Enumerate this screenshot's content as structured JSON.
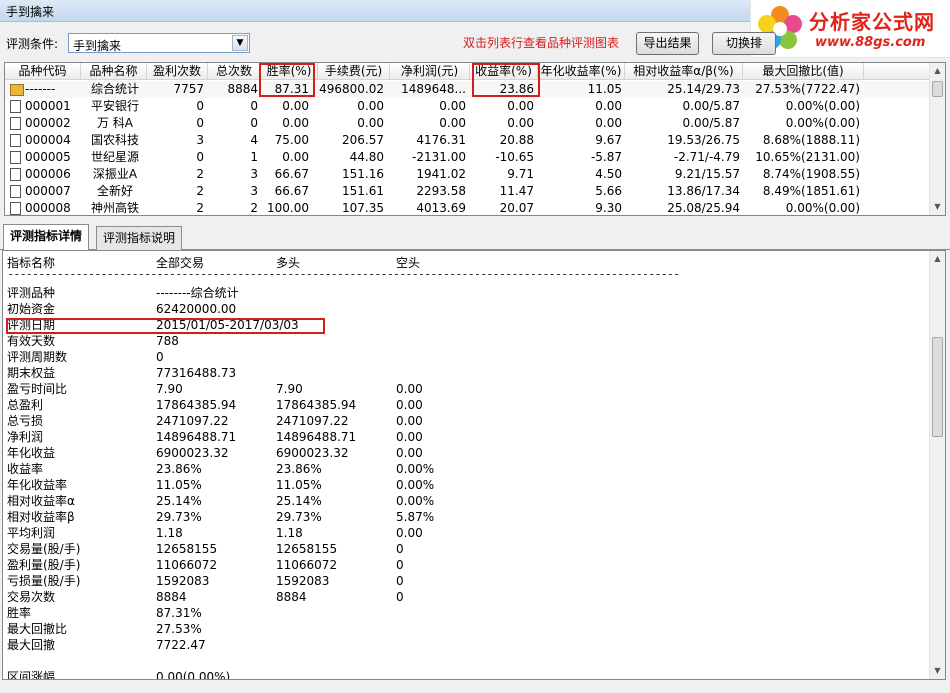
{
  "window": {
    "title": "手到擒来"
  },
  "logo": {
    "brand": "分析家公式网",
    "url": "www.88gs.com"
  },
  "toolbar": {
    "condition_label": "评测条件:",
    "condition_value": "手到擒来",
    "hint": "双击列表行查看品种评测图表",
    "export_label": "导出结果",
    "switch1_label": "切换排",
    "switch2_label": "切换分析"
  },
  "table": {
    "columns": [
      "品种代码",
      "品种名称",
      "盈利次数",
      "总次数",
      "胜率(%)",
      "手续费(元)",
      "净利润(元)",
      "收益率(%)",
      "年化收益率(%)",
      "相对收益率α/β(%)",
      "最大回撤比(值)"
    ],
    "rows": [
      {
        "code": "-------",
        "name": "综合统计",
        "win": "7757",
        "total": "8884",
        "rate": "87.31",
        "fee": "496800.02",
        "profit": "1489648...",
        "ret": "23.86",
        "annual": "11.05",
        "rel": "25.14/29.73",
        "dd": "27.53%(7722.47)",
        "icon": "folder"
      },
      {
        "code": "000001",
        "name": "平安银行",
        "win": "0",
        "total": "0",
        "rate": "0.00",
        "fee": "0.00",
        "profit": "0.00",
        "ret": "0.00",
        "annual": "0.00",
        "rel": "0.00/5.87",
        "dd": "0.00%(0.00)",
        "icon": "doc"
      },
      {
        "code": "000002",
        "name": "万 科A",
        "win": "0",
        "total": "0",
        "rate": "0.00",
        "fee": "0.00",
        "profit": "0.00",
        "ret": "0.00",
        "annual": "0.00",
        "rel": "0.00/5.87",
        "dd": "0.00%(0.00)",
        "icon": "doc"
      },
      {
        "code": "000004",
        "name": "国农科技",
        "win": "3",
        "total": "4",
        "rate": "75.00",
        "fee": "206.57",
        "profit": "4176.31",
        "ret": "20.88",
        "annual": "9.67",
        "rel": "19.53/26.75",
        "dd": "8.68%(1888.11)",
        "icon": "doc"
      },
      {
        "code": "000005",
        "name": "世纪星源",
        "win": "0",
        "total": "1",
        "rate": "0.00",
        "fee": "44.80",
        "profit": "-2131.00",
        "ret": "-10.65",
        "annual": "-5.87",
        "rel": "-2.71/-4.79",
        "dd": "10.65%(2131.00)",
        "icon": "doc"
      },
      {
        "code": "000006",
        "name": "深振业A",
        "win": "2",
        "total": "3",
        "rate": "66.67",
        "fee": "151.16",
        "profit": "1941.02",
        "ret": "9.71",
        "annual": "4.50",
        "rel": "9.21/15.57",
        "dd": "8.74%(1908.55)",
        "icon": "doc"
      },
      {
        "code": "000007",
        "name": "全新好",
        "win": "2",
        "total": "3",
        "rate": "66.67",
        "fee": "151.61",
        "profit": "2293.58",
        "ret": "11.47",
        "annual": "5.66",
        "rel": "13.86/17.34",
        "dd": "8.49%(1851.61)",
        "icon": "doc"
      },
      {
        "code": "000008",
        "name": "神州高铁",
        "win": "2",
        "total": "2",
        "rate": "100.00",
        "fee": "107.35",
        "profit": "4013.69",
        "ret": "20.07",
        "annual": "9.30",
        "rel": "25.08/25.94",
        "dd": "0.00%(0.00)",
        "icon": "doc"
      }
    ]
  },
  "tabs": [
    {
      "label": "评测指标详情",
      "active": true
    },
    {
      "label": "评测指标说明",
      "active": false
    }
  ],
  "detail": {
    "headers": [
      "指标名称",
      "全部交易",
      "多头",
      "空头"
    ],
    "dashes": "------------------------------------------------------------------------------------------------------------",
    "rows": [
      [
        "评测品种",
        "--------综合统计",
        "",
        ""
      ],
      [
        "初始资金",
        "62420000.00",
        "",
        ""
      ],
      [
        "评测日期",
        "2015/01/05-2017/03/03",
        "",
        ""
      ],
      [
        "有效天数",
        "788",
        "",
        ""
      ],
      [
        "评测周期数",
        "0",
        "",
        ""
      ],
      [
        "期末权益",
        "77316488.73",
        "",
        ""
      ],
      [
        "盈亏时间比",
        "7.90",
        "7.90",
        "0.00"
      ],
      [
        "总盈利",
        "17864385.94",
        "17864385.94",
        "0.00"
      ],
      [
        "总亏损",
        "2471097.22",
        "2471097.22",
        "0.00"
      ],
      [
        "净利润",
        "14896488.71",
        "14896488.71",
        "0.00"
      ],
      [
        "年化收益",
        "6900023.32",
        "6900023.32",
        "0.00"
      ],
      [
        "收益率",
        "23.86%",
        "23.86%",
        "0.00%"
      ],
      [
        "年化收益率",
        "11.05%",
        "11.05%",
        "0.00%"
      ],
      [
        "相对收益率α",
        "25.14%",
        "25.14%",
        "0.00%"
      ],
      [
        "相对收益率β",
        "29.73%",
        "29.73%",
        "5.87%"
      ],
      [
        "平均利润",
        "1.18",
        "1.18",
        "0.00"
      ],
      [
        "交易量(股/手)",
        "12658155",
        "12658155",
        "0"
      ],
      [
        "盈利量(股/手)",
        "11066072",
        "11066072",
        "0"
      ],
      [
        "亏损量(股/手)",
        "1592083",
        "1592083",
        "0"
      ],
      [
        "交易次数",
        "8884",
        "8884",
        "0"
      ],
      [
        "胜率",
        "87.31%",
        "",
        ""
      ],
      [
        "最大回撤比",
        "27.53%",
        "",
        ""
      ],
      [
        "最大回撤",
        "7722.47",
        "",
        ""
      ],
      [
        "",
        "",
        "",
        ""
      ],
      [
        "区间涨幅",
        "0.00(0.00%)",
        "",
        ""
      ]
    ]
  },
  "colors": {
    "highlight": "#d21e1e",
    "hint": "#d21e1e",
    "brand": "#e2231a"
  }
}
